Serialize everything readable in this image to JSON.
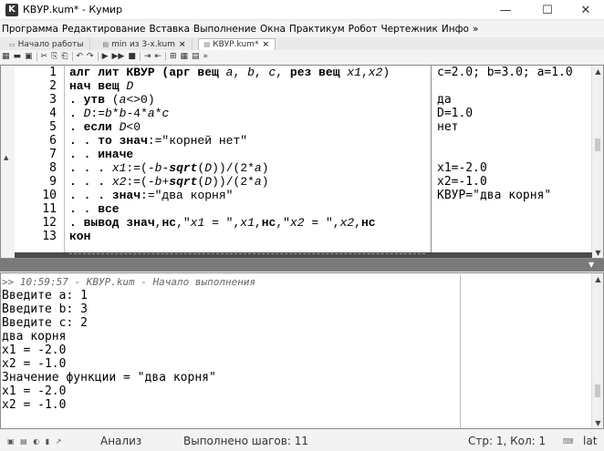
{
  "window": {
    "app_icon": "K",
    "title": "КВУР.kum* - Кумир",
    "minimize": "—",
    "maximize": "☐",
    "close": "✕"
  },
  "menu": [
    "Программа",
    "Редактирование",
    "Вставка",
    "Выполнение",
    "Окна",
    "Практикум",
    "Робот",
    "Чертежник",
    "Инфо",
    "»"
  ],
  "tabs": [
    {
      "label": "Начало работы",
      "icon": "▭",
      "close": ""
    },
    {
      "label": "min из 3-х.kum",
      "icon": "▤",
      "close": "×"
    },
    {
      "label": "КВУР.kum*",
      "icon": "▤",
      "close": "×"
    }
  ],
  "toolbar": {
    "icons": [
      "▦",
      "▬",
      "▣",
      "✂",
      "⎘",
      "⎗",
      "↶",
      "↷",
      "▶",
      "▶▶",
      "■",
      "⇥",
      "⇤",
      "⊞",
      "▦",
      "▤",
      "»"
    ]
  },
  "editor": {
    "line_numbers": [
      "1",
      "2",
      "3",
      "4",
      "5",
      "6",
      "7",
      "8",
      "9",
      "10",
      "11",
      "12",
      "13"
    ],
    "code_lines": [
      [
        {
          "t": "алг лит КВУР (",
          "c": "kw"
        },
        {
          "t": "арг вещ ",
          "c": "kw"
        },
        {
          "t": "a",
          "c": "vi"
        },
        {
          "t": ", ",
          "c": ""
        },
        {
          "t": "b",
          "c": "vi"
        },
        {
          "t": ", ",
          "c": ""
        },
        {
          "t": "c",
          "c": "vi"
        },
        {
          "t": ", ",
          "c": ""
        },
        {
          "t": "рез вещ ",
          "c": "kw"
        },
        {
          "t": "x1",
          "c": "vi"
        },
        {
          "t": ",",
          "c": ""
        },
        {
          "t": "x2",
          "c": "vi"
        },
        {
          "t": ")",
          "c": ""
        }
      ],
      [
        {
          "t": "нач вещ ",
          "c": "kw"
        },
        {
          "t": "D",
          "c": "vi"
        }
      ],
      [
        {
          "t": ". утв ",
          "c": "kw"
        },
        {
          "t": "(",
          "c": ""
        },
        {
          "t": "a",
          "c": "vi"
        },
        {
          "t": "<>0)",
          "c": ""
        }
      ],
      [
        {
          "t": ". ",
          "c": "kw"
        },
        {
          "t": "D",
          "c": "vi"
        },
        {
          "t": ":=",
          "c": ""
        },
        {
          "t": "b",
          "c": "vi"
        },
        {
          "t": "*",
          "c": ""
        },
        {
          "t": "b",
          "c": "vi"
        },
        {
          "t": "-4*",
          "c": ""
        },
        {
          "t": "a",
          "c": "vi"
        },
        {
          "t": "*",
          "c": ""
        },
        {
          "t": "c",
          "c": "vi"
        }
      ],
      [
        {
          "t": ". если ",
          "c": "kw"
        },
        {
          "t": "D",
          "c": "vi"
        },
        {
          "t": "<0",
          "c": ""
        }
      ],
      [
        {
          "t": ". . то ",
          "c": "kw"
        },
        {
          "t": "знач",
          "c": "kw"
        },
        {
          "t": ":=\"корней нет\"",
          "c": ""
        }
      ],
      [
        {
          "t": ". . иначе",
          "c": "kw"
        }
      ],
      [
        {
          "t": ". . . ",
          "c": "kw"
        },
        {
          "t": "x1",
          "c": "vi"
        },
        {
          "t": ":=(-",
          "c": ""
        },
        {
          "t": "b",
          "c": "vi"
        },
        {
          "t": "-",
          "c": ""
        },
        {
          "t": "sqrt",
          "c": "fn"
        },
        {
          "t": "(",
          "c": ""
        },
        {
          "t": "D",
          "c": "vi"
        },
        {
          "t": "))/(2*",
          "c": ""
        },
        {
          "t": "a",
          "c": "vi"
        },
        {
          "t": ")",
          "c": ""
        }
      ],
      [
        {
          "t": ". . . ",
          "c": "kw"
        },
        {
          "t": "x2",
          "c": "vi"
        },
        {
          "t": ":=(-",
          "c": ""
        },
        {
          "t": "b",
          "c": "vi"
        },
        {
          "t": "+",
          "c": ""
        },
        {
          "t": "sqrt",
          "c": "fn"
        },
        {
          "t": "(",
          "c": ""
        },
        {
          "t": "D",
          "c": "vi"
        },
        {
          "t": "))/(2*",
          "c": ""
        },
        {
          "t": "a",
          "c": "vi"
        },
        {
          "t": ")",
          "c": ""
        }
      ],
      [
        {
          "t": ". . . ",
          "c": "kw"
        },
        {
          "t": "знач",
          "c": "kw"
        },
        {
          "t": ":=\"два корня\"",
          "c": ""
        }
      ],
      [
        {
          "t": ". . все",
          "c": "kw"
        }
      ],
      [
        {
          "t": ". вывод ",
          "c": "kw"
        },
        {
          "t": "знач",
          "c": "kw"
        },
        {
          "t": ",",
          "c": ""
        },
        {
          "t": "нс",
          "c": "kw"
        },
        {
          "t": ",\"",
          "c": ""
        },
        {
          "t": "x1",
          "c": "vi"
        },
        {
          "t": " = \",",
          "c": ""
        },
        {
          "t": "x1",
          "c": "vi"
        },
        {
          "t": ",",
          "c": ""
        },
        {
          "t": "нс",
          "c": "kw"
        },
        {
          "t": ",\"",
          "c": ""
        },
        {
          "t": "x2",
          "c": "vi"
        },
        {
          "t": " = \",",
          "c": ""
        },
        {
          "t": "x2",
          "c": "vi"
        },
        {
          "t": ",",
          "c": ""
        },
        {
          "t": "нс",
          "c": "kw"
        }
      ],
      [
        {
          "t": "кон",
          "c": "kw"
        }
      ]
    ],
    "margin_lines": [
      "c=2.0; b=3.0; a=1.0",
      "",
      "да",
      "D=1.0",
      "нет",
      "",
      "",
      "x1=-2.0",
      "x2=-1.0",
      "КВУР=\"два корня\"",
      "",
      "",
      ""
    ]
  },
  "console": {
    "lines": [
      {
        "text": ">> 10:59:57 - КВУР.kum - Начало выполнения",
        "meta": true
      },
      {
        "text": "Введите a: 1",
        "meta": false
      },
      {
        "text": "Введите b: 3",
        "meta": false
      },
      {
        "text": "Введите c: 2",
        "meta": false
      },
      {
        "text": "два корня",
        "meta": false
      },
      {
        "text": "x1 = -2.0",
        "meta": false
      },
      {
        "text": "x2 = -1.0",
        "meta": false
      },
      {
        "text": "Значение функции = \"два корня\"",
        "meta": false
      },
      {
        "text": "x1 = -2.0",
        "meta": false
      },
      {
        "text": "x2 = -1.0",
        "meta": false
      }
    ]
  },
  "status": {
    "icons": [
      "▣",
      "▤",
      "◐",
      "▮",
      "↗"
    ],
    "mode": "Анализ",
    "steps": "Выполнено шагов: 11",
    "position": "Стр: 1, Кол: 1",
    "keyboard_icon": "⌨",
    "lang": "lat"
  }
}
